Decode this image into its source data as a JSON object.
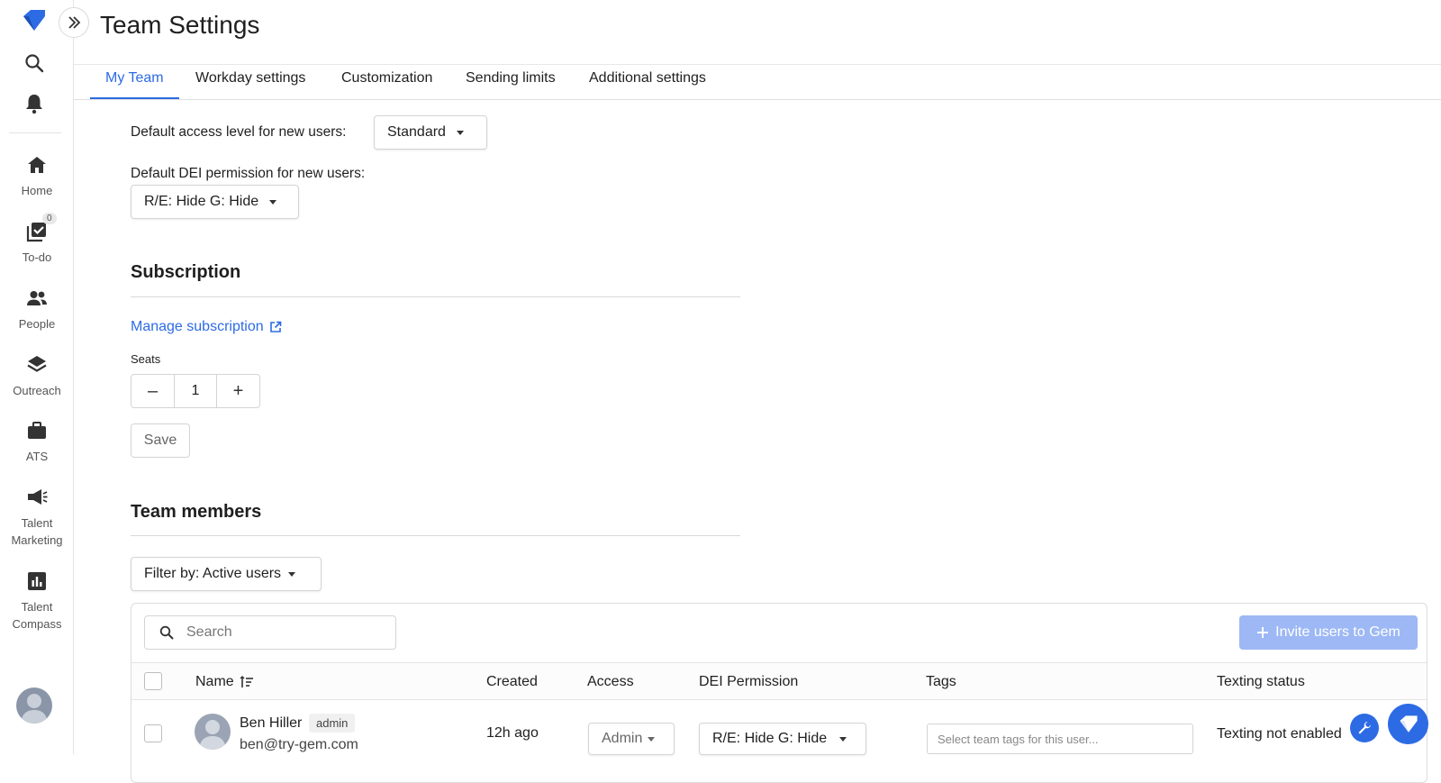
{
  "app": {
    "page_title": "Team Settings",
    "accent_color": "#2d6be4",
    "logo_icon": "gem-logo-icon"
  },
  "rail": {
    "search_icon": "search-icon",
    "notifications_icon": "bell-icon",
    "items": [
      {
        "label": "Home",
        "icon": "home-icon"
      },
      {
        "label": "To-do",
        "icon": "todo-icon",
        "badge": "0"
      },
      {
        "label": "People",
        "icon": "people-icon"
      },
      {
        "label": "Outreach",
        "icon": "layers-icon"
      },
      {
        "label": "ATS",
        "icon": "briefcase-icon"
      },
      {
        "label": "Talent Marketing",
        "icon": "megaphone-icon"
      },
      {
        "label": "Talent Compass",
        "icon": "chart-icon"
      }
    ]
  },
  "tabs": [
    {
      "label": "My Team",
      "active": true
    },
    {
      "label": "Workday settings",
      "active": false
    },
    {
      "label": "Customization",
      "active": false
    },
    {
      "label": "Sending limits",
      "active": false
    },
    {
      "label": "Additional settings",
      "active": false
    }
  ],
  "defaults": {
    "access_label": "Default access level for new users:",
    "access_value": "Standard",
    "dei_label": "Default DEI permission for new users:",
    "dei_value": "R/E: Hide G: Hide"
  },
  "subscription": {
    "title": "Subscription",
    "manage_link": "Manage subscription",
    "seats_label": "Seats",
    "seats_value": "1",
    "decrement": "–",
    "increment": "+",
    "save_label": "Save"
  },
  "team_members": {
    "title": "Team members",
    "filter_label": "Filter by: Active users",
    "search_placeholder": "Search",
    "invite_label": "Invite users to Gem",
    "columns": [
      "Name",
      "Created",
      "Access",
      "DEI Permission",
      "Tags",
      "Texting status"
    ],
    "rows": [
      {
        "name": "Ben Hiller",
        "email": "ben@try-gem.com",
        "role_badge": "admin",
        "created": "12h ago",
        "access": "Admin",
        "dei_permission": "R/E: Hide G: Hide",
        "tags_placeholder": "Select team tags for this user...",
        "texting_status": "Texting not enabled"
      }
    ]
  }
}
